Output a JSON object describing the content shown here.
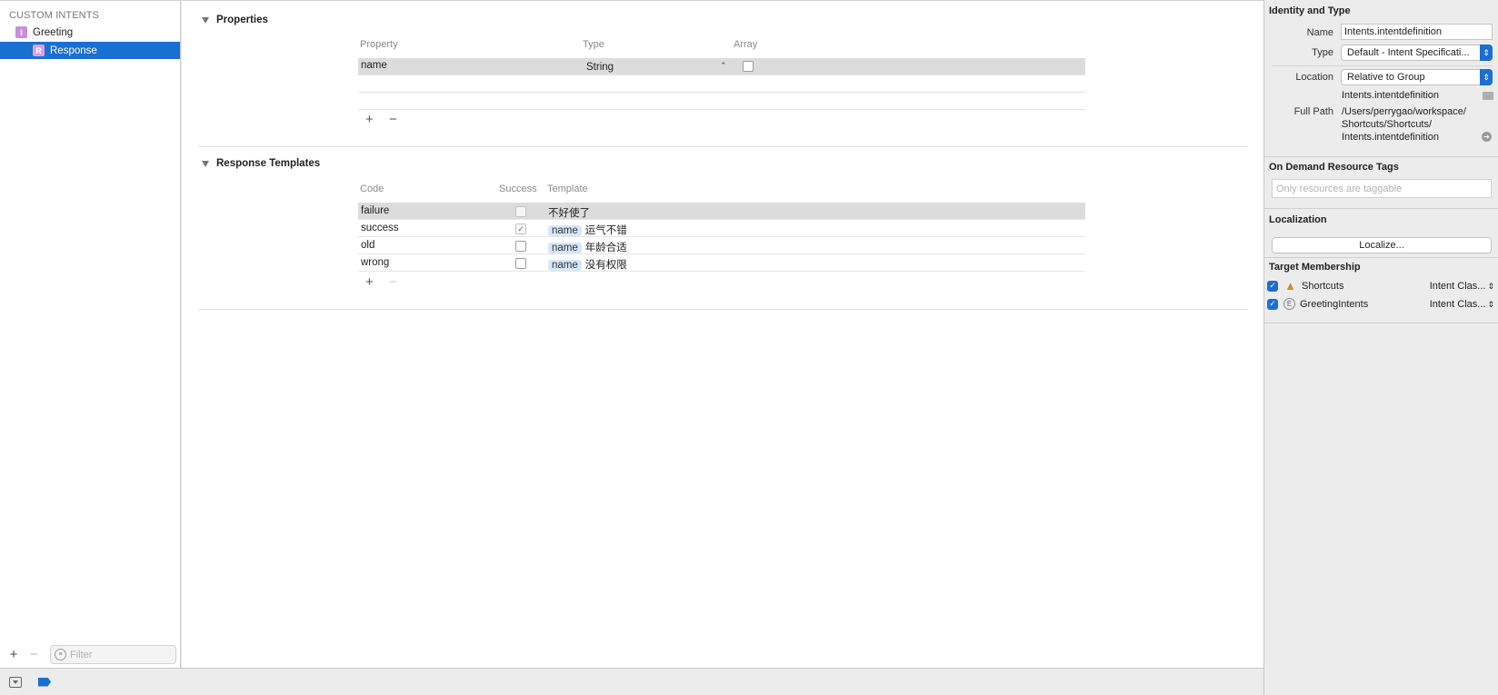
{
  "navigator": {
    "section_title": "CUSTOM INTENTS",
    "items": [
      {
        "badge": "I",
        "label": "Greeting"
      },
      {
        "badge": "R",
        "label": "Response"
      }
    ],
    "filter_placeholder": "Filter",
    "add_symbol": "+",
    "remove_symbol": "−"
  },
  "properties": {
    "title": "Properties",
    "columns": {
      "property": "Property",
      "type": "Type",
      "array": "Array"
    },
    "rows": [
      {
        "property": "name",
        "type": "String",
        "array": false
      }
    ],
    "add_symbol": "+",
    "remove_symbol": "−"
  },
  "response_templates": {
    "title": "Response Templates",
    "columns": {
      "code": "Code",
      "success": "Success",
      "template": "Template"
    },
    "rows": [
      {
        "code": "failure",
        "success": false,
        "token": "",
        "text": "不好使了"
      },
      {
        "code": "success",
        "success": true,
        "token": "name",
        "text": "运气不错"
      },
      {
        "code": "old",
        "success": false,
        "token": "name",
        "text": "年龄合适"
      },
      {
        "code": "wrong",
        "success": false,
        "token": "name",
        "text": "没有权限"
      }
    ],
    "add_symbol": "+",
    "remove_symbol": "−"
  },
  "inspector": {
    "identity": {
      "title": "Identity and Type",
      "name_label": "Name",
      "name_value": "Intents.intentdefinition",
      "type_label": "Type",
      "type_value": "Default - Intent Specificati...",
      "location_label": "Location",
      "location_value": "Relative to Group",
      "location_file": "Intents.intentdefinition",
      "full_path_label": "Full Path",
      "full_path_lines": [
        "/Users/perrygao/workspace/",
        "Shortcuts/Shortcuts/",
        "Intents.intentdefinition"
      ]
    },
    "odr": {
      "title": "On Demand Resource Tags",
      "placeholder": "Only resources are taggable"
    },
    "localization": {
      "title": "Localization",
      "button": "Localize..."
    },
    "target_membership": {
      "title": "Target Membership",
      "targets": [
        {
          "name": "Shortcuts",
          "class": "Intent Clas...",
          "checked": true,
          "icon": "app-icon"
        },
        {
          "name": "GreetingIntents",
          "class": "Intent Clas...",
          "checked": true,
          "icon": "extension-icon"
        }
      ]
    }
  },
  "colors": {
    "selection": "#1a6fd2",
    "badge": "#c88ed8",
    "token": "#d7e7fb"
  }
}
